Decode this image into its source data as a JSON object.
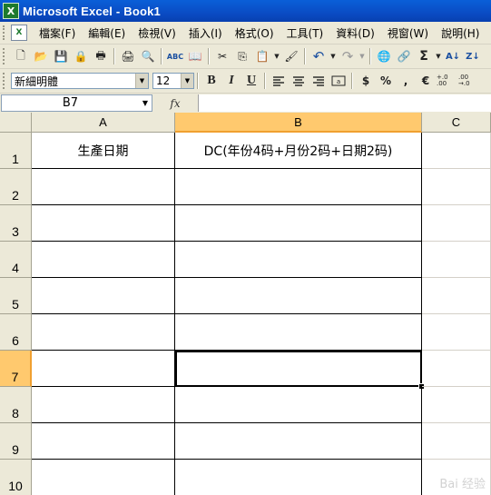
{
  "window": {
    "title": "Microsoft Excel - Book1",
    "app_icon": "X"
  },
  "menu": {
    "doc_icon": "X",
    "items": [
      "檔案(F)",
      "編輯(E)",
      "檢視(V)",
      "插入(I)",
      "格式(O)",
      "工具(T)",
      "資料(D)",
      "視窗(W)",
      "說明(H)"
    ]
  },
  "toolbar_standard": {
    "buttons": [
      "new-icon",
      "open-icon",
      "save-icon",
      "permission-icon",
      "print-preview-icon",
      "print-icon",
      "preview-icon",
      "spelling-icon",
      "research-icon",
      "cut-icon",
      "copy-icon",
      "paste-icon",
      "format-painter-icon",
      "undo-icon",
      "redo-icon",
      "hyperlink-icon",
      "autosum-icon",
      "sort-asc-icon",
      "sort-desc-icon"
    ],
    "glyphs": {
      "new-icon": "🗋",
      "open-icon": "📂",
      "save-icon": "💾",
      "permission-icon": "🔒",
      "print-preview-icon": "🖶",
      "print-icon": "🖨",
      "preview-icon": "🔍",
      "spelling-icon": "ABC",
      "research-icon": "📖",
      "cut-icon": "✂",
      "copy-icon": "⎘",
      "paste-icon": "📋",
      "format-painter-icon": "🖌",
      "undo-icon": "↶",
      "redo-icon": "↷",
      "hyperlink-icon": "🌐",
      "autosum-icon": "Σ",
      "sort-asc-icon": "A↓",
      "sort-desc-icon": "Z↓"
    }
  },
  "toolbar_format": {
    "font_name": "新細明體",
    "font_size": "12",
    "bold": "B",
    "italic": "I",
    "underline": "U",
    "percent": "%",
    "comma": ",",
    "currency": "$",
    "euro": "€",
    "inc_decimal": "+.0 .00",
    "dec_decimal": ".00 →.0"
  },
  "formula_bar": {
    "name_box": "B7",
    "fx": "fx",
    "content": ""
  },
  "sheet": {
    "columns": [
      "A",
      "B",
      "C"
    ],
    "selected_column": "B",
    "rows": [
      "1",
      "2",
      "3",
      "4",
      "5",
      "6",
      "7",
      "8",
      "9",
      "10"
    ],
    "selected_row": "7",
    "cells": {
      "A1": "生產日期",
      "B1": "DC(年份4码+月份2码+日期2码)"
    },
    "active_cell": "B7"
  },
  "watermark": "Bai 经验"
}
